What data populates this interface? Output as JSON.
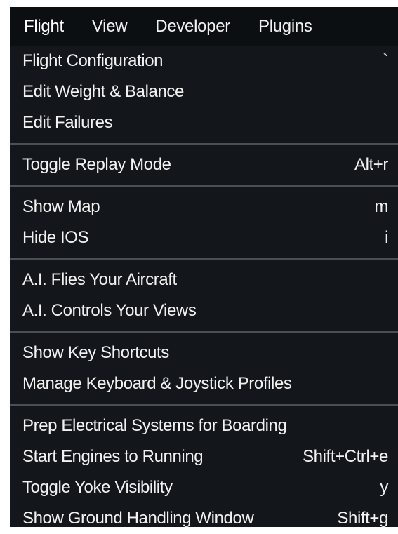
{
  "menubar": {
    "items": [
      "Flight",
      "View",
      "Developer",
      "Plugins"
    ]
  },
  "dropdown": {
    "groups": [
      [
        {
          "label": "Flight Configuration",
          "shortcut": "`"
        },
        {
          "label": "Edit Weight & Balance",
          "shortcut": ""
        },
        {
          "label": "Edit Failures",
          "shortcut": ""
        }
      ],
      [
        {
          "label": "Toggle Replay Mode",
          "shortcut": "Alt+r"
        }
      ],
      [
        {
          "label": "Show Map",
          "shortcut": "m"
        },
        {
          "label": "Hide IOS",
          "shortcut": "i"
        }
      ],
      [
        {
          "label": "A.I. Flies Your Aircraft",
          "shortcut": ""
        },
        {
          "label": "A.I. Controls Your Views",
          "shortcut": ""
        }
      ],
      [
        {
          "label": "Show Key Shortcuts",
          "shortcut": ""
        },
        {
          "label": "Manage Keyboard & Joystick Profiles",
          "shortcut": ""
        }
      ],
      [
        {
          "label": "Prep Electrical Systems for Boarding",
          "shortcut": ""
        },
        {
          "label": "Start Engines to Running",
          "shortcut": "Shift+Ctrl+e"
        },
        {
          "label": "Toggle Yoke Visibility",
          "shortcut": "y"
        },
        {
          "label": "Show Ground Handling Window",
          "shortcut": "Shift+g"
        }
      ]
    ]
  }
}
